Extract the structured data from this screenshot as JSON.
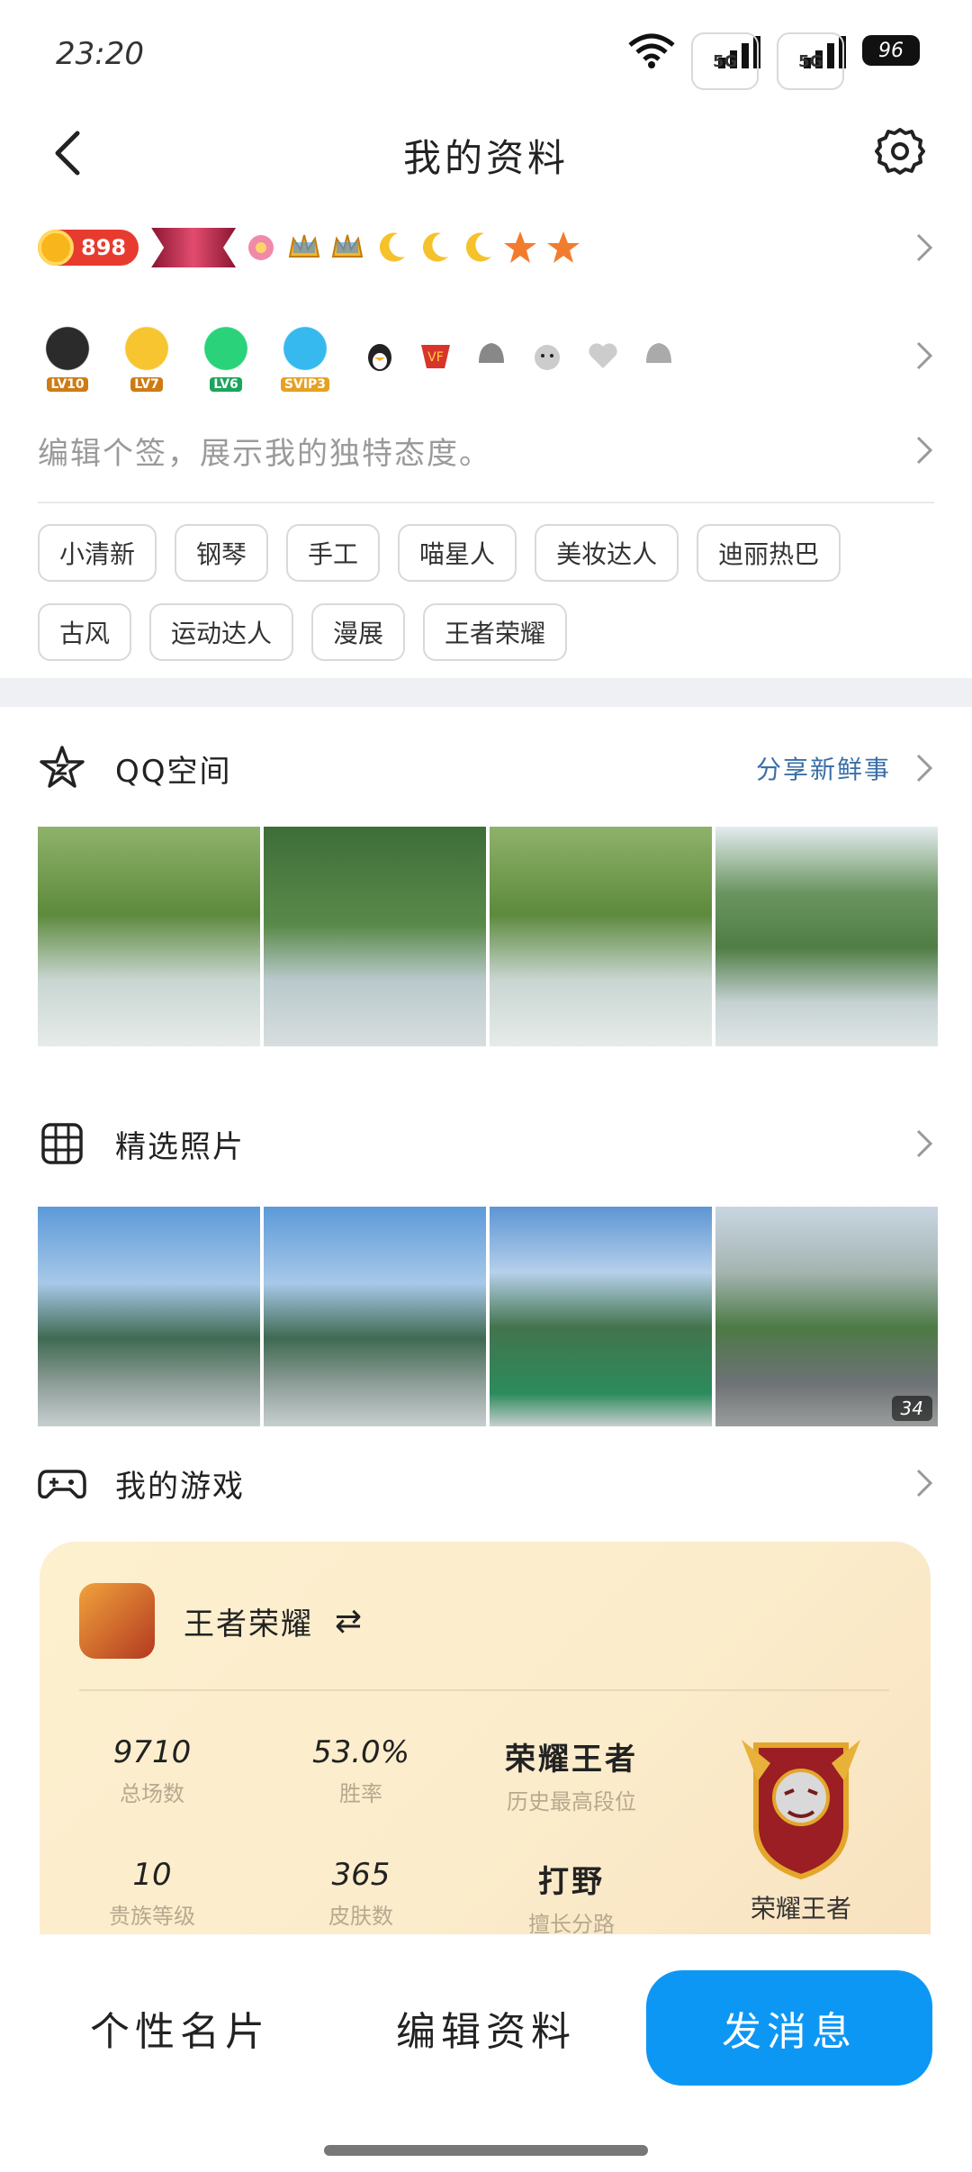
{
  "status_bar": {
    "time": "23:20",
    "signal1": "5G",
    "signal2": "5G",
    "battery": "96"
  },
  "nav": {
    "title": "我的资料"
  },
  "badges": {
    "coin_value": "898",
    "row2_labels": [
      "LV10",
      "LV7",
      "LV6",
      "SVIP3"
    ]
  },
  "signature": {
    "placeholder": "编辑个签，展示我的独特态度。"
  },
  "tags": [
    "小清新",
    "钢琴",
    "手工",
    "喵星人",
    "美妆达人",
    "迪丽热巴",
    "古风",
    "运动达人",
    "漫展",
    "王者荣耀"
  ],
  "qzone": {
    "title": "QQ空间",
    "action": "分享新鲜事"
  },
  "featured": {
    "title": "精选照片",
    "count": "34"
  },
  "games": {
    "title": "我的游戏",
    "game_name": "王者荣耀",
    "stats": [
      {
        "value": "9710",
        "label": "总场数"
      },
      {
        "value": "53.0%",
        "label": "胜率"
      },
      {
        "value": "荣耀王者",
        "label": "历史最高段位"
      },
      {
        "value": "10",
        "label": "贵族等级"
      },
      {
        "value": "365",
        "label": "皮肤数"
      },
      {
        "value": "打野",
        "label": "擅长分路"
      }
    ],
    "rank_label": "荣耀王者"
  },
  "bottom": {
    "card": "个性名片",
    "edit": "编辑资料",
    "send": "发消息"
  },
  "colors": {
    "accent": "#0d97f5",
    "link": "#3a6fa8"
  }
}
